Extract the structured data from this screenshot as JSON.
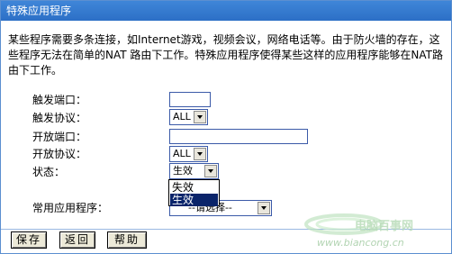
{
  "header": {
    "title": "特殊应用程序"
  },
  "description": "某些程序需要多条连接，如Internet游戏，视频会议，网络电话等。由于防火墙的存在，这些程序无法在简单的NAT 路由下工作。特殊应用程序使得某些这样的应用程序能够在NAT路由下工作。",
  "form": {
    "trigger_port_label": "触发端口：",
    "trigger_port_value": "",
    "trigger_protocol_label": "触发协议：",
    "trigger_protocol_value": "ALL",
    "open_port_label": "开放端口：",
    "open_port_value": "",
    "open_protocol_label": "开放协议：",
    "open_protocol_value": "ALL",
    "status_label": "状态：",
    "status_value": "生效",
    "status_options": [
      "失效",
      "生效"
    ],
    "common_apps_label": "常用应用程序：",
    "common_apps_value": "--请选择--"
  },
  "buttons": {
    "save": "保存",
    "back": "返回",
    "help": "帮助"
  },
  "watermark": {
    "text": "电脑百事网",
    "url": "www.biancong.cn"
  },
  "colors": {
    "titlebar": "#2c6fc6",
    "selected_option": "#0a246a"
  }
}
